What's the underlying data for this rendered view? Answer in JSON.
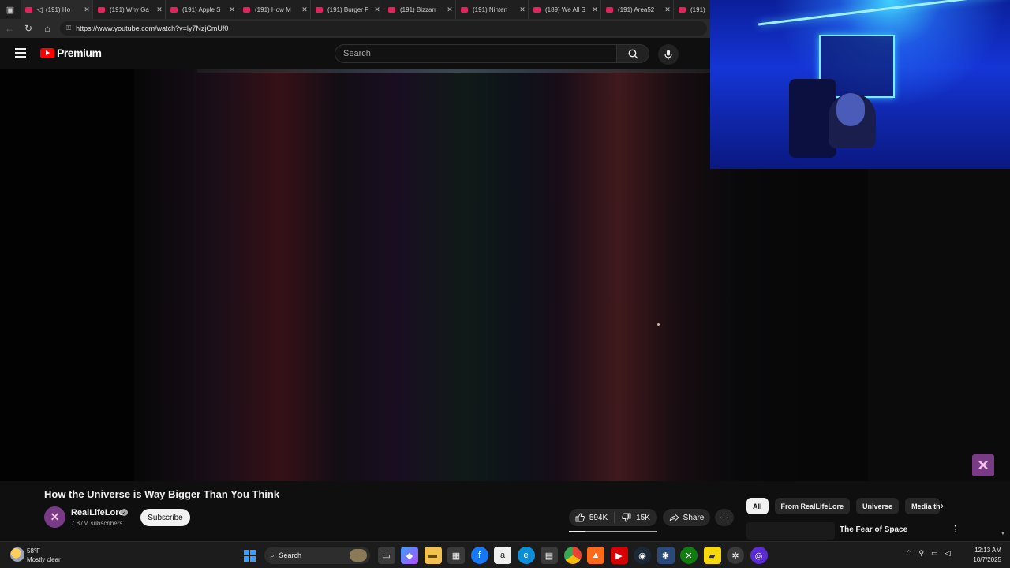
{
  "browser": {
    "tabs": [
      {
        "label": "(191) Ho",
        "muted_icon": true,
        "active": true
      },
      {
        "label": "(191) Why Ga"
      },
      {
        "label": "(191) Apple S"
      },
      {
        "label": "(191) How M"
      },
      {
        "label": "(191) Burger F"
      },
      {
        "label": "(191) Bizzarr"
      },
      {
        "label": "(191) Ninten"
      },
      {
        "label": "(189) We All S"
      },
      {
        "label": "(191) Area52"
      },
      {
        "label": "(191)"
      }
    ],
    "url": "https://www.youtube.com/watch?v=ly7NzjCmUf0"
  },
  "youtube": {
    "logo_word": "Premium",
    "search_placeholder": "Search"
  },
  "video": {
    "title": "How the Universe is Way Bigger Than You Think",
    "channel_name": "RealLifeLore",
    "channel_subscribers": "7.87M subscribers",
    "subscribe_label": "Subscribe",
    "likes": "594K",
    "dislikes": "15K",
    "share_label": "Share",
    "more_label": "···"
  },
  "sidebar": {
    "chips": [
      {
        "label": "All",
        "selected": true
      },
      {
        "label": "From RealLifeLore"
      },
      {
        "label": "Universe"
      },
      {
        "label": "Media th"
      }
    ],
    "recommendation_title": "The Fear of Space"
  },
  "taskbar": {
    "weather_temp": "58°F",
    "weather_desc": "Mostly clear",
    "search_label": "Search",
    "time": "12:13 AM",
    "date": "10/7/2025"
  },
  "colors": {
    "youtube_red": "#ff0000",
    "background": "#0f0f0f",
    "chip_bg": "#272727"
  }
}
